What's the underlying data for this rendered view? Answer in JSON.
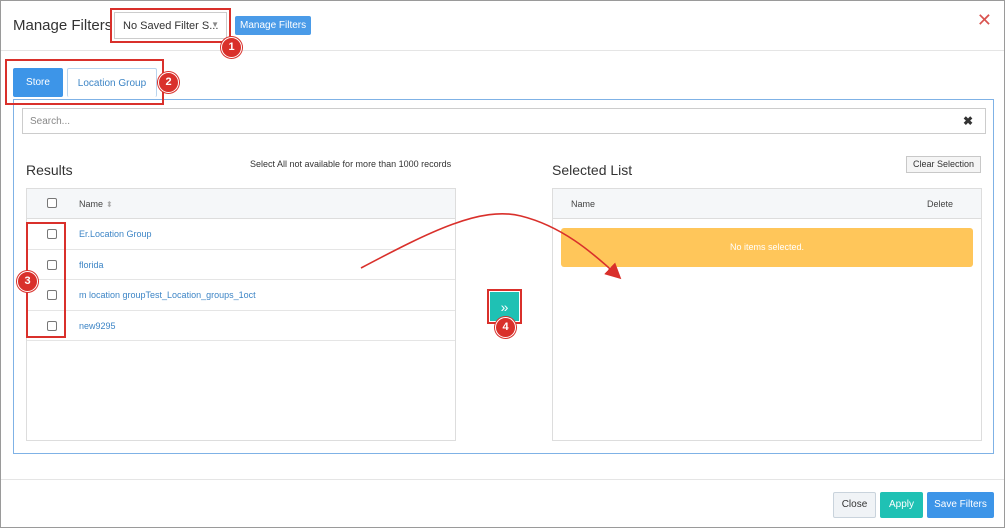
{
  "header": {
    "title": "Manage Filters",
    "saved_filter_value": "No Saved Filter S...",
    "manage_filters_label": "Manage Filters",
    "close_glyph": "✕"
  },
  "tabs": [
    {
      "label": "Store",
      "active": true
    },
    {
      "label": "Location Group",
      "active": false
    }
  ],
  "search": {
    "placeholder": "Search...",
    "clear_glyph": "✖"
  },
  "results": {
    "heading": "Results",
    "notice": "Select All not available for more than 1000 records",
    "column_name": "Name",
    "rows": [
      {
        "label": "Er.Location Group"
      },
      {
        "label": "florida"
      },
      {
        "label": "m location groupTest_Location_groups_1oct"
      },
      {
        "label": "new9295"
      }
    ]
  },
  "move_button_glyph": "»",
  "selected": {
    "heading": "Selected List",
    "clear_label": "Clear Selection",
    "column_name": "Name",
    "column_delete": "Delete",
    "empty_message": "No items selected."
  },
  "footer": {
    "close_label": "Close",
    "apply_label": "Apply",
    "save_label": "Save Filters"
  },
  "annotations": [
    "1",
    "2",
    "3",
    "4"
  ],
  "colors": {
    "primary": "#3d95e8",
    "teal": "#1fc1b4",
    "warning": "#ffc65a",
    "annotation_red": "#d9302b"
  },
  "icons": {
    "close": "close-icon",
    "caret": "caret-down-icon",
    "sort": "sort-icon",
    "move": "double-chevron-right-icon",
    "clear_search": "clear-search-icon"
  }
}
